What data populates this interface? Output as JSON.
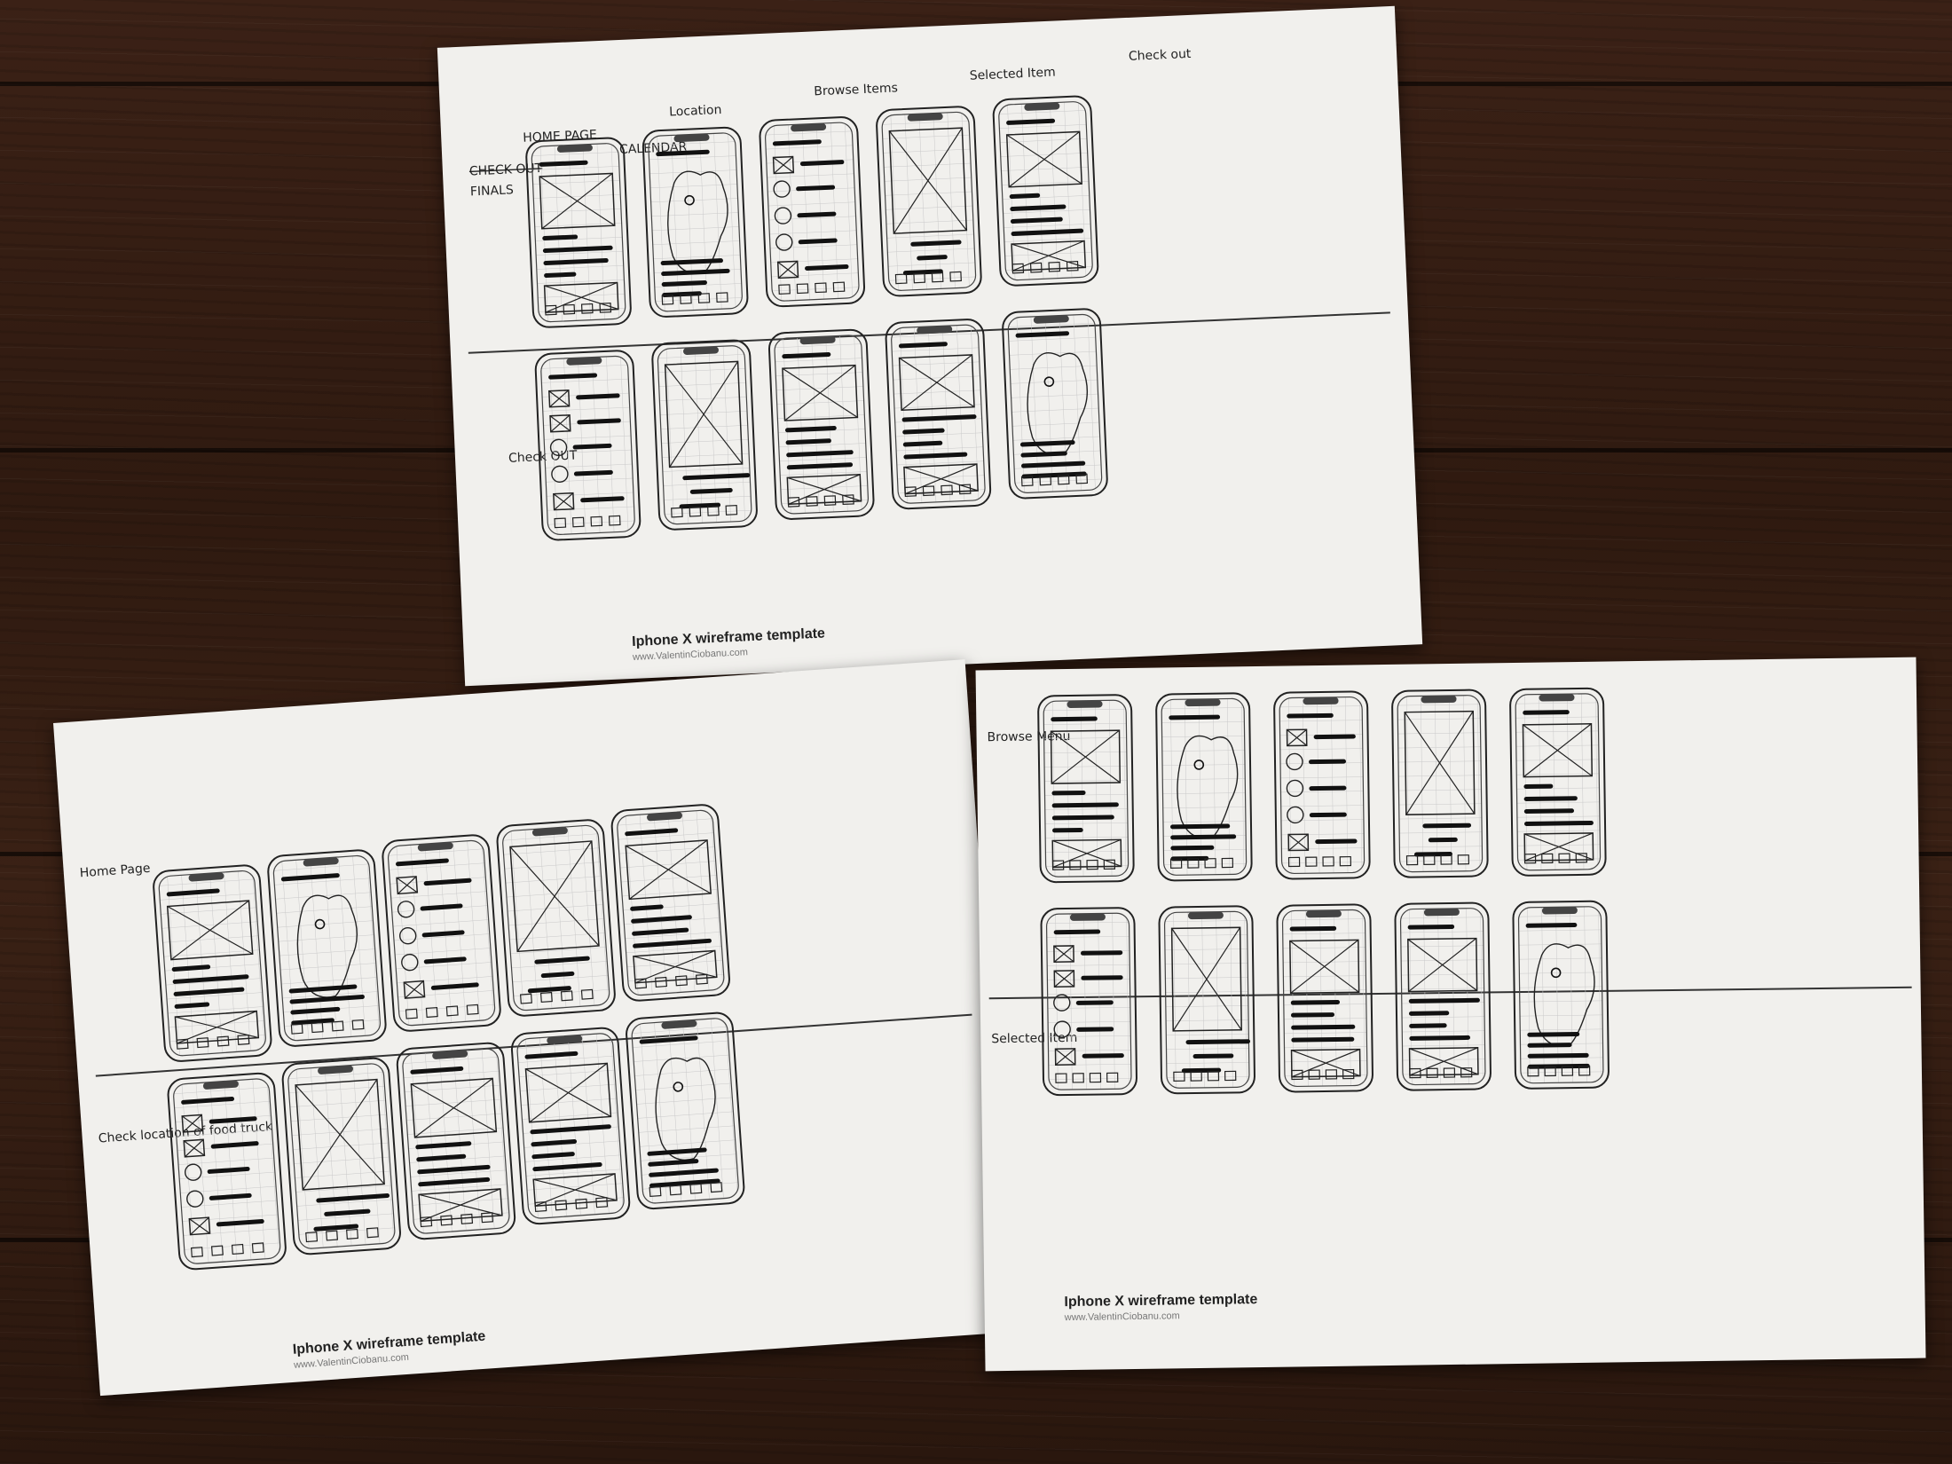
{
  "scene": {
    "surface_color": "#331d12",
    "paper_color": "#f1f0ed",
    "ink_color": "#111111"
  },
  "sheets": [
    {
      "id": "sheet-top",
      "labels": {
        "home_page": "HOME PAGE",
        "location": "Location",
        "browse_items": "Browse Items",
        "selected_item": "Selected Item",
        "check_out_top": "Check out",
        "calendar": "CALENDAR",
        "finals": "FINALS",
        "crossed_out": "CHECK OUT",
        "check_out_row": "Check OUT"
      },
      "caption": "Iphone X wireframe template",
      "url": "www.ValentinCiobanu.com"
    },
    {
      "id": "sheet-left",
      "labels": {
        "home_page": "Home Page",
        "check_location": "Check location of food truck"
      },
      "caption": "Iphone X wireframe template",
      "url": "www.ValentinCiobanu.com"
    },
    {
      "id": "sheet-right",
      "labels": {
        "browse_menu": "Browse Menu",
        "selected_item": "Selected Item"
      },
      "caption": "Iphone X wireframe template",
      "url": "www.ValentinCiobanu.com"
    }
  ]
}
